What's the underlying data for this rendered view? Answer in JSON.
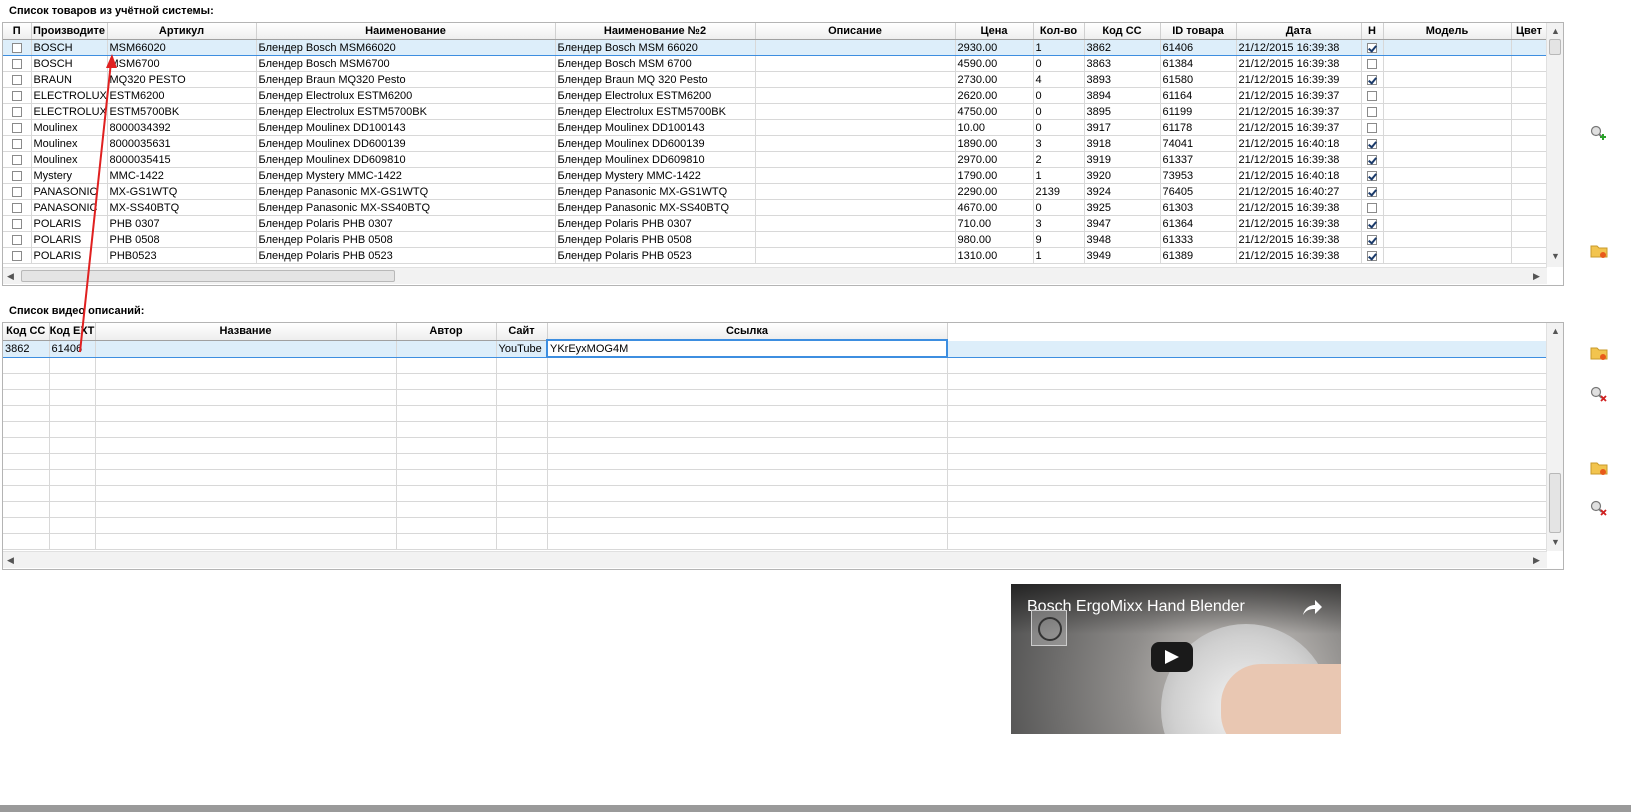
{
  "products": {
    "title": "Список товаров из учётной системы:",
    "columns": [
      "П",
      "Производите",
      "Артикул",
      "Наименование",
      "Наименование №2",
      "Описание",
      "Цена",
      "Кол-во",
      "Код СС",
      "ID товара",
      "Дата",
      "Н",
      "Модель",
      "Цвет"
    ],
    "rows": [
      {
        "p": false,
        "maker": "BOSCH",
        "article": "MSM66020",
        "name": "Блендер Bosch MSM66020",
        "name2": "Блендер Bosch MSM 66020",
        "price": "2930.00",
        "qty": "1",
        "code": "3862",
        "id": "61406",
        "date": "21/12/2015 16:39:38",
        "n": true
      },
      {
        "p": false,
        "maker": "BOSCH",
        "article": "MSM6700",
        "name": "Блендер Bosch MSM6700",
        "name2": "Блендер Bosch MSM 6700",
        "price": "4590.00",
        "qty": "0",
        "code": "3863",
        "id": "61384",
        "date": "21/12/2015 16:39:38",
        "n": false
      },
      {
        "p": false,
        "maker": "BRAUN",
        "article": "MQ320 PESTO",
        "name": "Блендер Braun MQ320 Pesto",
        "name2": "Блендер Braun MQ 320 Pesto",
        "price": "2730.00",
        "qty": "4",
        "code": "3893",
        "id": "61580",
        "date": "21/12/2015 16:39:39",
        "n": true
      },
      {
        "p": false,
        "maker": "ELECTROLUX",
        "article": "ESTM6200",
        "name": "Блендер Electrolux ESTM6200",
        "name2": "Блендер Electrolux ESTM6200",
        "price": "2620.00",
        "qty": "0",
        "code": "3894",
        "id": "61164",
        "date": "21/12/2015 16:39:37",
        "n": false
      },
      {
        "p": false,
        "maker": "ELECTROLUX",
        "article": "ESTM5700BK",
        "name": "Блендер Electrolux ESTM5700BK",
        "name2": "Блендер Electrolux ESTM5700BK",
        "price": "4750.00",
        "qty": "0",
        "code": "3895",
        "id": "61199",
        "date": "21/12/2015 16:39:37",
        "n": false
      },
      {
        "p": false,
        "maker": "Moulinex",
        "article": "8000034392",
        "name": "Блендер Moulinex DD100143",
        "name2": "Блендер Moulinex DD100143",
        "price": "10.00",
        "qty": "0",
        "code": "3917",
        "id": "61178",
        "date": "21/12/2015 16:39:37",
        "n": false
      },
      {
        "p": false,
        "maker": "Moulinex",
        "article": "8000035631",
        "name": "Блендер Moulinex DD600139",
        "name2": "Блендер Moulinex DD600139",
        "price": "1890.00",
        "qty": "3",
        "code": "3918",
        "id": "74041",
        "date": "21/12/2015 16:40:18",
        "n": true
      },
      {
        "p": false,
        "maker": "Moulinex",
        "article": "8000035415",
        "name": "Блендер Moulinex DD609810",
        "name2": "Блендер Moulinex DD609810",
        "price": "2970.00",
        "qty": "2",
        "code": "3919",
        "id": "61337",
        "date": "21/12/2015 16:39:38",
        "n": true
      },
      {
        "p": false,
        "maker": "Mystery",
        "article": "MMC-1422",
        "name": "Блендер Mystery MMC-1422",
        "name2": "Блендер Mystery MMC-1422",
        "price": "1790.00",
        "qty": "1",
        "code": "3920",
        "id": "73953",
        "date": "21/12/2015 16:40:18",
        "n": true
      },
      {
        "p": false,
        "maker": "PANASONIC",
        "article": "MX-GS1WTQ",
        "name": "Блендер Panasonic MX-GS1WTQ",
        "name2": "Блендер Panasonic MX-GS1WTQ",
        "price": "2290.00",
        "qty": "2139",
        "code": "3924",
        "id": "76405",
        "date": "21/12/2015 16:40:27",
        "n": true
      },
      {
        "p": false,
        "maker": "PANASONIC",
        "article": "MX-SS40BTQ",
        "name": "Блендер Panasonic MX-SS40BTQ",
        "name2": "Блендер Panasonic MX-SS40BTQ",
        "price": "4670.00",
        "qty": "0",
        "code": "3925",
        "id": "61303",
        "date": "21/12/2015 16:39:38",
        "n": false
      },
      {
        "p": false,
        "maker": "POLARIS",
        "article": "PHB 0307",
        "name": "Блендер Polaris PHB 0307",
        "name2": "Блендер Polaris PHB 0307",
        "price": "710.00",
        "qty": "3",
        "code": "3947",
        "id": "61364",
        "date": "21/12/2015 16:39:38",
        "n": true
      },
      {
        "p": false,
        "maker": "POLARIS",
        "article": "PHB 0508",
        "name": "Блендер Polaris PHB 0508",
        "name2": "Блендер Polaris PHB 0508",
        "price": "980.00",
        "qty": "9",
        "code": "3948",
        "id": "61333",
        "date": "21/12/2015 16:39:38",
        "n": true
      },
      {
        "p": false,
        "maker": "POLARIS",
        "article": "PHB0523",
        "name": "Блендер Polaris PHB 0523",
        "name2": "Блендер Polaris PHB 0523",
        "price": "1310.00",
        "qty": "1",
        "code": "3949",
        "id": "61389",
        "date": "21/12/2015 16:39:38",
        "n": true
      }
    ]
  },
  "videos": {
    "title": "Список видео описаний:",
    "columns": [
      "Код СС",
      "Код EXT",
      "Название",
      "Автор",
      "Сайт",
      "Ссылка"
    ],
    "row": {
      "code": "3862",
      "ext": "61406",
      "name": "",
      "author": "",
      "site": "YouTube",
      "link": "YKrEyxMOG4M"
    }
  },
  "player": {
    "title": "Bosch ErgoMixx Hand Blender"
  },
  "icons": {
    "side": [
      "magnifier-add-icon",
      "folder-icon",
      "folder-icon",
      "magnifier-remove-icon",
      "folder-icon",
      "magnifier-remove-icon"
    ],
    "video": [
      "share-icon",
      "play-icon"
    ]
  },
  "colors": {
    "selection": "#ddeefa",
    "selection_border": "#3d8ee0",
    "arrow": "#e02020",
    "play_button": "#1a1a1a"
  }
}
